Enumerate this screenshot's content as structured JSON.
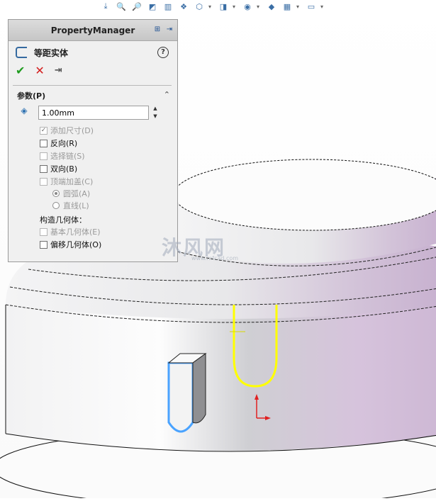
{
  "property_manager": {
    "title": "PropertyManager",
    "feature_title": "等距实体",
    "help_label": "?",
    "group_title": "参数(P)",
    "distance_value": "1.00mm",
    "options": [
      {
        "label": "添加尺寸(D)",
        "checked": true,
        "enabled": false
      },
      {
        "label": "反向(R)",
        "checked": false,
        "enabled": true
      },
      {
        "label": "选择链(S)",
        "checked": false,
        "enabled": false
      },
      {
        "label": "双向(B)",
        "checked": false,
        "enabled": true
      },
      {
        "label": "顶端加盖(C)",
        "checked": false,
        "enabled": false
      }
    ],
    "cap_options": [
      {
        "label": "圆弧(A)",
        "selected": true
      },
      {
        "label": "直线(L)",
        "selected": false
      }
    ],
    "construction_label": "构造几何体：",
    "construction_options": [
      {
        "label": "基本几何体(E)",
        "checked": false,
        "enabled": false
      },
      {
        "label": "偏移几何体(O)",
        "checked": false,
        "enabled": true
      }
    ]
  },
  "watermark": {
    "text": "沐风网",
    "sub": "www.mfcad.com"
  },
  "colors": {
    "sketch_yellow": "#ffff00",
    "selection_blue": "#4aa3ff",
    "model_gray": "#e4e4e6",
    "tint": "#d8c6de"
  }
}
